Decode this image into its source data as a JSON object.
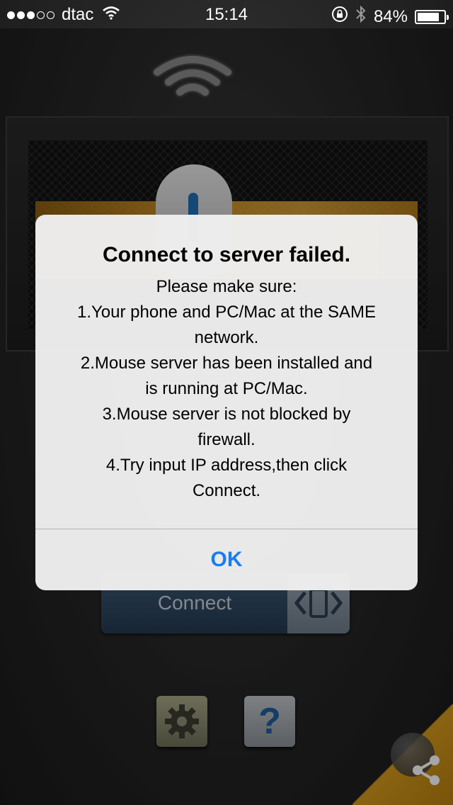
{
  "status_bar": {
    "carrier": "dtac",
    "time": "15:14",
    "battery_percent_text": "84%",
    "battery_level": 0.84,
    "icons": [
      "signal-dots",
      "wifi-icon",
      "rotation-lock-icon",
      "bluetooth-icon",
      "battery-icon"
    ]
  },
  "app": {
    "connect_label": "Connect",
    "help_label": "?",
    "accent_color": "#e8a22a",
    "connect_color": "#2f4a66"
  },
  "alert": {
    "title": "Connect to server failed.",
    "message_lines": [
      "Please make sure:",
      "1.Your phone and PC/Mac at the SAME",
      "network.",
      "2.Mouse server has been installed and",
      "is running at PC/Mac.",
      "3.Mouse server is not blocked by",
      "firewall.",
      "4.Try input IP address,then click",
      "Connect."
    ],
    "ok_label": "OK",
    "ok_color": "#1a7cf0"
  }
}
